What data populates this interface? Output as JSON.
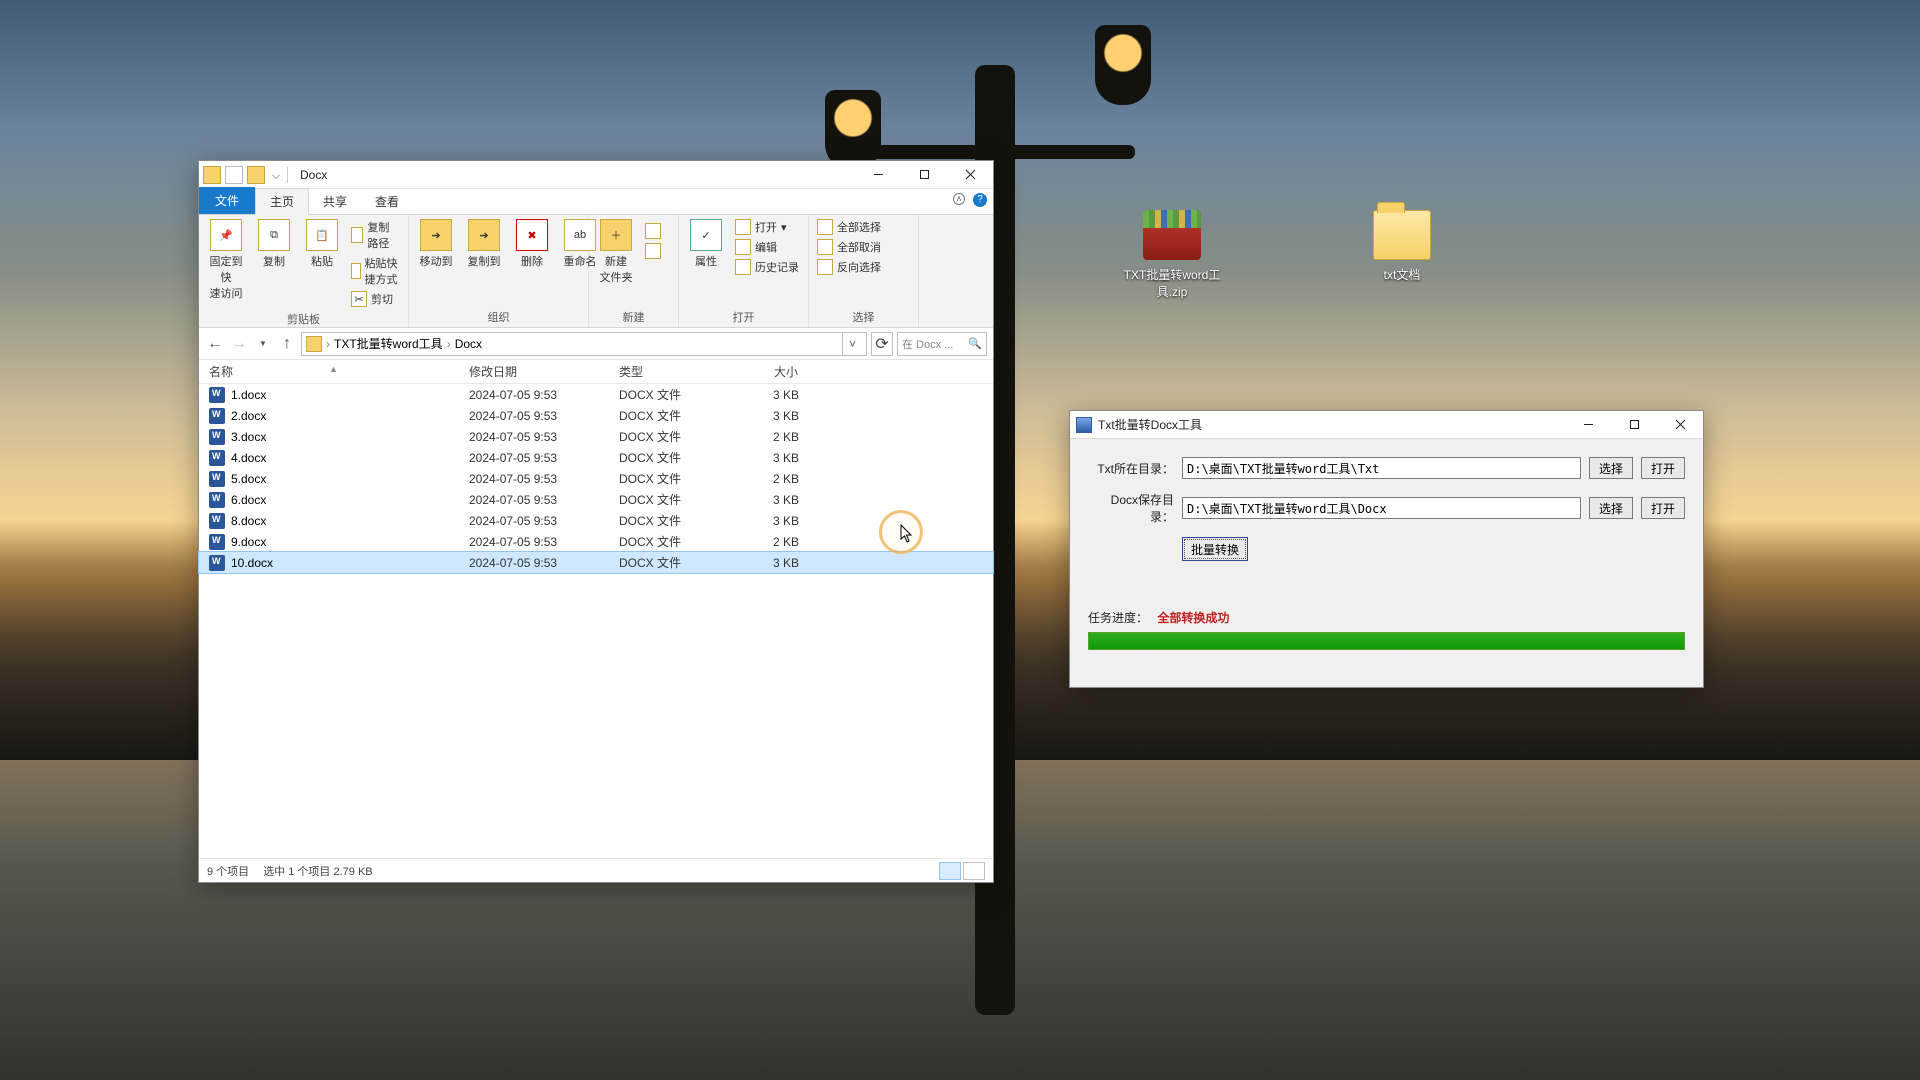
{
  "desktop_icons": {
    "zip": "TXT批量转word工具.zip",
    "folder": "txt文档"
  },
  "explorer": {
    "title": "Docx",
    "tabs": {
      "file": "文件",
      "home": "主页",
      "share": "共享",
      "view": "查看"
    },
    "ribbon": {
      "pin": "固定到快\n速访问",
      "copy": "复制",
      "paste": "粘贴",
      "copy_path": "复制路径",
      "paste_shortcut": "粘贴快捷方式",
      "cut": "剪切",
      "clipboard": "剪贴板",
      "move_to": "移动到",
      "copy_to": "复制到",
      "delete": "删除",
      "rename": "重命名",
      "organize": "组织",
      "new_folder": "新建\n文件夹",
      "new_group": "新建",
      "properties": "属性",
      "open": "打开",
      "edit": "编辑",
      "history": "历史记录",
      "open_group": "打开",
      "select_all": "全部选择",
      "select_none": "全部取消",
      "invert": "反向选择",
      "select_group": "选择"
    },
    "breadcrumb": {
      "root": "TXT批量转word工具",
      "current": "Docx"
    },
    "search_placeholder": "在 Docx ...",
    "columns": {
      "name": "名称",
      "date": "修改日期",
      "type": "类型",
      "size": "大小"
    },
    "files": [
      {
        "name": "1.docx",
        "date": "2024-07-05 9:53",
        "type": "DOCX 文件",
        "size": "3 KB",
        "selected": false
      },
      {
        "name": "2.docx",
        "date": "2024-07-05 9:53",
        "type": "DOCX 文件",
        "size": "3 KB",
        "selected": false
      },
      {
        "name": "3.docx",
        "date": "2024-07-05 9:53",
        "type": "DOCX 文件",
        "size": "2 KB",
        "selected": false
      },
      {
        "name": "4.docx",
        "date": "2024-07-05 9:53",
        "type": "DOCX 文件",
        "size": "3 KB",
        "selected": false
      },
      {
        "name": "5.docx",
        "date": "2024-07-05 9:53",
        "type": "DOCX 文件",
        "size": "2 KB",
        "selected": false
      },
      {
        "name": "6.docx",
        "date": "2024-07-05 9:53",
        "type": "DOCX 文件",
        "size": "3 KB",
        "selected": false
      },
      {
        "name": "8.docx",
        "date": "2024-07-05 9:53",
        "type": "DOCX 文件",
        "size": "3 KB",
        "selected": false
      },
      {
        "name": "9.docx",
        "date": "2024-07-05 9:53",
        "type": "DOCX 文件",
        "size": "2 KB",
        "selected": false
      },
      {
        "name": "10.docx",
        "date": "2024-07-05 9:53",
        "type": "DOCX 文件",
        "size": "3 KB",
        "selected": true
      }
    ],
    "status": {
      "count": "9 个项目",
      "selection": "选中 1 个项目  2.79 KB"
    }
  },
  "tool": {
    "title": "Txt批量转Docx工具",
    "txt_dir_label": "Txt所在目录：",
    "txt_dir_value": "D:\\桌面\\TXT批量转word工具\\Txt",
    "docx_dir_label": "Docx保存目录：",
    "docx_dir_value": "D:\\桌面\\TXT批量转word工具\\Docx",
    "choose": "选择",
    "open": "打开",
    "convert": "批量转换",
    "progress_label": "任务进度：",
    "progress_value": "全部转换成功"
  }
}
